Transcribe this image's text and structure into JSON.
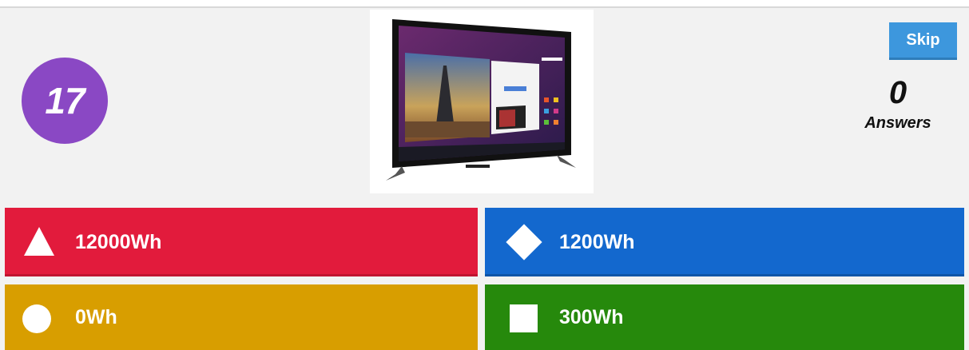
{
  "timer": {
    "value": "17"
  },
  "image": {
    "icon": "television-image"
  },
  "skip": {
    "label": "Skip"
  },
  "answers_count": {
    "value": "0",
    "label": "Answers"
  },
  "options": [
    {
      "label": "12000Wh",
      "shape": "triangle-icon",
      "color": "#e21b3c"
    },
    {
      "label": "1200Wh",
      "shape": "diamond-icon",
      "color": "#1368ce"
    },
    {
      "label": "0Wh",
      "shape": "circle-icon",
      "color": "#d89e00"
    },
    {
      "label": "300Wh",
      "shape": "square-icon",
      "color": "#26890c"
    }
  ]
}
